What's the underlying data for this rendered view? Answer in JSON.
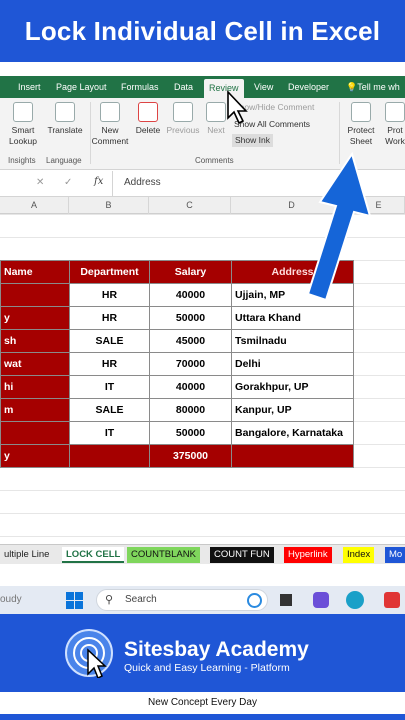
{
  "banner": {
    "title": "Lock Individual Cell in Excel"
  },
  "ribbon": {
    "tabs": [
      "Insert",
      "Page Layout",
      "Formulas",
      "Data",
      "Review",
      "View",
      "Developer",
      "Tell me wh"
    ],
    "active_tab": "Review",
    "smart_lookup": "Smart Lookup",
    "translate": "Translate",
    "new_comment": "New Comment",
    "delete": "Delete",
    "previous": "Previous",
    "next": "Next",
    "show_hide_comment": "Show/Hide Comment",
    "show_all_comments": "Show All Comments",
    "show_ink": "Show Ink",
    "protect_sheet": "Protect Sheet",
    "protect_workbook": "Prot Work",
    "group_insights": "Insights",
    "group_language": "Language",
    "group_comments": "Comments"
  },
  "formula_bar": {
    "fx": "fx",
    "value": "Address"
  },
  "columns": [
    "A",
    "B",
    "C",
    "D",
    "E"
  ],
  "table": {
    "headers": [
      "Name",
      "Department",
      "Salary",
      "Address"
    ],
    "rows": [
      [
        "",
        "HR",
        "40000",
        "Ujjain, MP"
      ],
      [
        "y",
        "HR",
        "50000",
        "Uttara Khand"
      ],
      [
        "sh",
        "SALE",
        "45000",
        "Tsmilnadu"
      ],
      [
        "wat",
        "HR",
        "70000",
        "Delhi"
      ],
      [
        "hi",
        "IT",
        "40000",
        "Gorakhpur, UP"
      ],
      [
        "m",
        "SALE",
        "80000",
        "Kanpur, UP"
      ],
      [
        "",
        "IT",
        "50000",
        "Bangalore, Karnataka"
      ]
    ],
    "total": [
      "y",
      "",
      "375000",
      ""
    ]
  },
  "sheet_tabs": [
    {
      "label": "ultiple Line",
      "bg": "#e9e9e9",
      "fg": "#222"
    },
    {
      "label": "LOCK CELL",
      "bg": "#ffffff",
      "fg": "#217346"
    },
    {
      "label": "COUNTBLANK",
      "bg": "#7fd65c",
      "fg": "#111"
    },
    {
      "label": "COUNT FUN",
      "bg": "#111111",
      "fg": "#ffffff"
    },
    {
      "label": "Hyperlink",
      "bg": "#ff0000",
      "fg": "#ffffff"
    },
    {
      "label": "Index",
      "bg": "#ffff00",
      "fg": "#111"
    },
    {
      "label": "Mo",
      "bg": "#1f56d6",
      "fg": "#ffffff"
    }
  ],
  "taskbar": {
    "weather": "oudy",
    "search": "Search"
  },
  "brand": {
    "name": "Sitesbay Academy",
    "subtitle": "Quick and Easy Learning - Platform",
    "tagline": "New Concept Every Day"
  },
  "colors": {
    "excel_green": "#217346",
    "table_red": "#a50000",
    "brand_blue": "#1f56d6",
    "arrow_blue": "#1565d8"
  }
}
